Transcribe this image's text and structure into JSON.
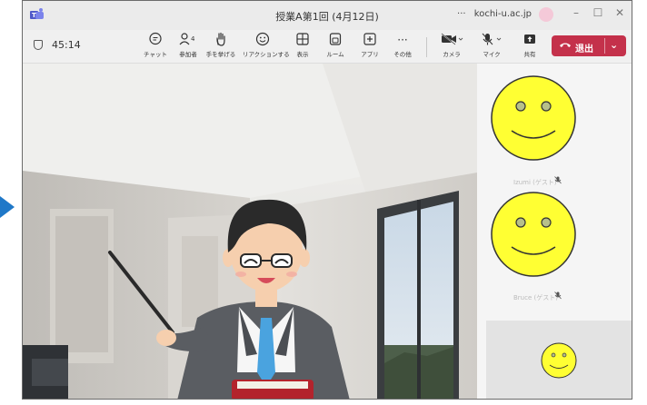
{
  "window": {
    "title": "授業A第1回 (4月12日)",
    "account": "kochi-u.ac.jp",
    "account_menu": "···"
  },
  "toolbar": {
    "timer": "45:14",
    "participant_count": "4",
    "buttons": [
      {
        "label": "チャット",
        "icon": "chat-icon"
      },
      {
        "label": "参加者",
        "icon": "people-icon"
      },
      {
        "label": "手を挙げる",
        "icon": "raise-hand-icon"
      },
      {
        "label": "リアクションする",
        "icon": "reaction-icon"
      },
      {
        "label": "表示",
        "icon": "view-icon"
      },
      {
        "label": "ルーム",
        "icon": "rooms-icon"
      },
      {
        "label": "アプリ",
        "icon": "apps-icon"
      },
      {
        "label": "その他",
        "icon": "more-icon"
      },
      {
        "label": "カメラ",
        "icon": "camera-off-icon"
      },
      {
        "label": "マイク",
        "icon": "mic-off-icon"
      },
      {
        "label": "共有",
        "icon": "share-icon"
      }
    ],
    "leave_label": "退出"
  },
  "participants": [
    {
      "name": "Izumi (ゲスト)",
      "muted": true
    },
    {
      "name": "Bruce (ゲスト)",
      "muted": true
    }
  ],
  "colors": {
    "leave": "#c4314b",
    "smiley": "#ffff33",
    "arrow": "#1f78c8"
  }
}
